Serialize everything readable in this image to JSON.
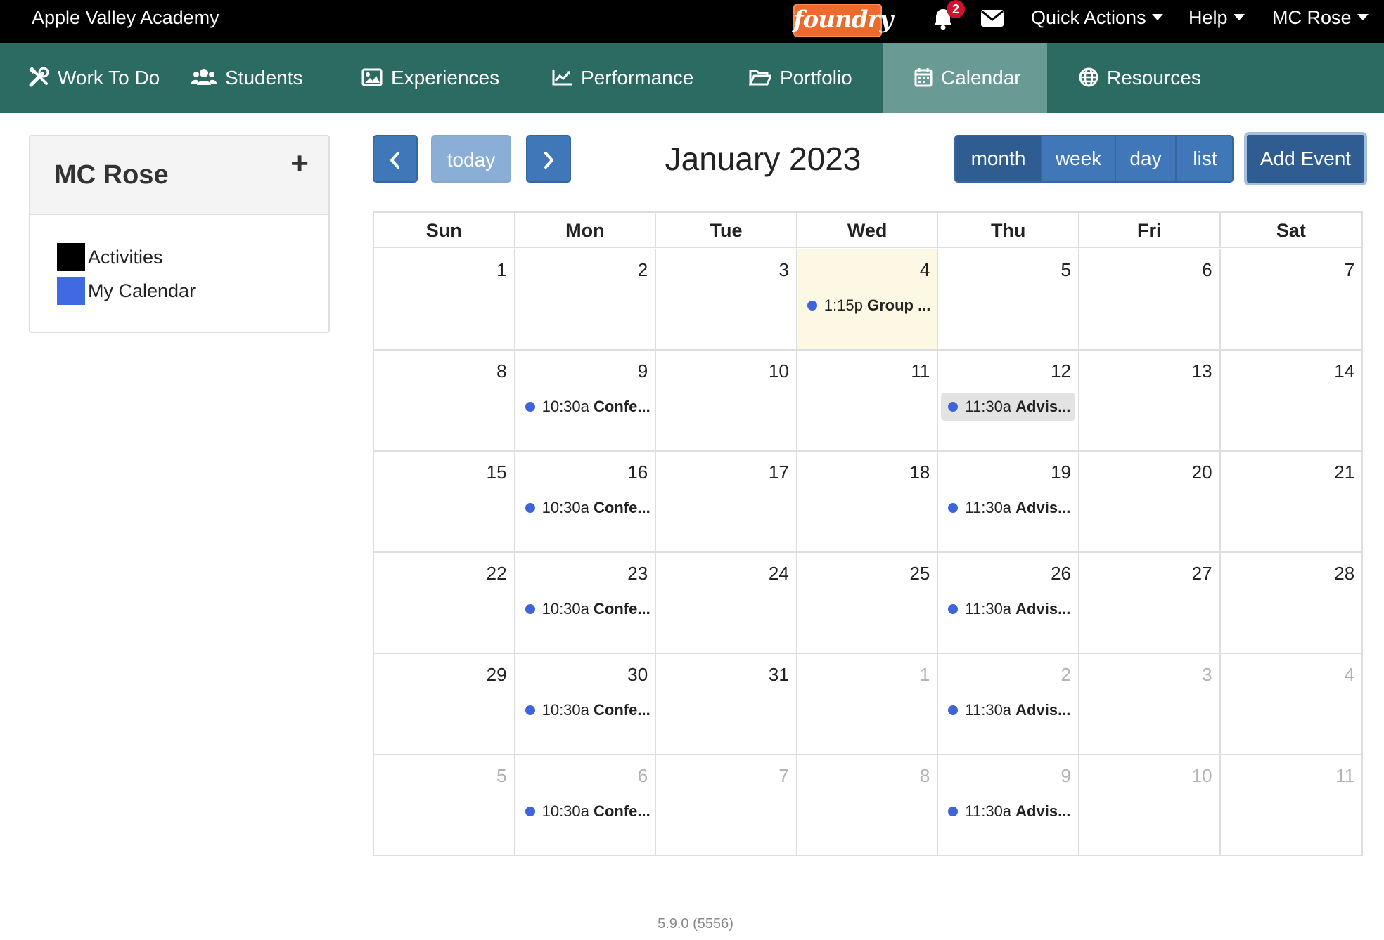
{
  "topbar": {
    "school": "Apple Valley Academy",
    "logo": "foundry",
    "notification_count": "2",
    "menus": [
      "Quick Actions",
      "Help",
      "MC Rose"
    ]
  },
  "nav": {
    "items": [
      {
        "label": "Work To Do",
        "icon": "tools-icon"
      },
      {
        "label": "Students",
        "icon": "users-icon"
      },
      {
        "label": "Experiences",
        "icon": "image-icon"
      },
      {
        "label": "Performance",
        "icon": "chart-line-icon"
      },
      {
        "label": "Portfolio",
        "icon": "folder-open-icon"
      },
      {
        "label": "Calendar",
        "icon": "calendar-icon",
        "active": true
      },
      {
        "label": "Resources",
        "icon": "globe-icon"
      }
    ]
  },
  "sidebar": {
    "title": "MC Rose",
    "add": "+",
    "legend": [
      {
        "label": "Activities",
        "color": "#000000"
      },
      {
        "label": "My Calendar",
        "color": "#4169e1"
      }
    ]
  },
  "toolbar": {
    "today": "today",
    "title": "January 2023",
    "views": [
      "month",
      "week",
      "day",
      "list"
    ],
    "active_view": "month",
    "add_event": "Add Event"
  },
  "calendar": {
    "weekdays": [
      "Sun",
      "Mon",
      "Tue",
      "Wed",
      "Thu",
      "Fri",
      "Sat"
    ],
    "weeks": [
      [
        {
          "d": "1"
        },
        {
          "d": "2"
        },
        {
          "d": "3"
        },
        {
          "d": "4",
          "today": true,
          "event": {
            "time": "1:15p",
            "title": "Group ..."
          }
        },
        {
          "d": "5"
        },
        {
          "d": "6"
        },
        {
          "d": "7"
        }
      ],
      [
        {
          "d": "8"
        },
        {
          "d": "9",
          "event": {
            "time": "10:30a",
            "title": "Confe..."
          }
        },
        {
          "d": "10"
        },
        {
          "d": "11"
        },
        {
          "d": "12",
          "event": {
            "time": "11:30a",
            "title": "Advis...",
            "highlight": true
          }
        },
        {
          "d": "13"
        },
        {
          "d": "14"
        }
      ],
      [
        {
          "d": "15"
        },
        {
          "d": "16",
          "event": {
            "time": "10:30a",
            "title": "Confe..."
          }
        },
        {
          "d": "17"
        },
        {
          "d": "18"
        },
        {
          "d": "19",
          "event": {
            "time": "11:30a",
            "title": "Advis..."
          }
        },
        {
          "d": "20"
        },
        {
          "d": "21"
        }
      ],
      [
        {
          "d": "22"
        },
        {
          "d": "23",
          "event": {
            "time": "10:30a",
            "title": "Confe..."
          }
        },
        {
          "d": "24"
        },
        {
          "d": "25"
        },
        {
          "d": "26",
          "event": {
            "time": "11:30a",
            "title": "Advis..."
          }
        },
        {
          "d": "27"
        },
        {
          "d": "28"
        }
      ],
      [
        {
          "d": "29"
        },
        {
          "d": "30",
          "event": {
            "time": "10:30a",
            "title": "Confe..."
          }
        },
        {
          "d": "31"
        },
        {
          "d": "1",
          "other": true
        },
        {
          "d": "2",
          "other": true,
          "event": {
            "time": "11:30a",
            "title": "Advis..."
          }
        },
        {
          "d": "3",
          "other": true
        },
        {
          "d": "4",
          "other": true
        }
      ],
      [
        {
          "d": "5",
          "other": true
        },
        {
          "d": "6",
          "other": true,
          "event": {
            "time": "10:30a",
            "title": "Confe..."
          }
        },
        {
          "d": "7",
          "other": true
        },
        {
          "d": "8",
          "other": true
        },
        {
          "d": "9",
          "other": true,
          "event": {
            "time": "11:30a",
            "title": "Advis..."
          }
        },
        {
          "d": "10",
          "other": true
        },
        {
          "d": "11",
          "other": true
        }
      ]
    ]
  },
  "footer": {
    "version": "5.9.0 (5556)"
  }
}
